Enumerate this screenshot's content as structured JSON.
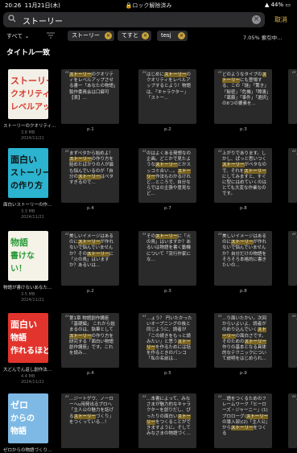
{
  "status": {
    "time": "20:26",
    "date": "11月21日(木)",
    "lock": "ロック解除済み",
    "battery": "44%"
  },
  "search": {
    "query": "ストーリー",
    "cancel": "取消"
  },
  "filter": {
    "dropdown": "すべて ⌄",
    "chips": [
      "ストーリー",
      "てすと",
      "tesj"
    ],
    "progress": "7.05% 索引中..."
  },
  "section_title": "タイトル一致",
  "rows": [
    {
      "name": "ストーリーのクオリティ...",
      "size": "3.8 MB",
      "date": "2024/11/21",
      "cover": {
        "bg": "#f2efe6",
        "fg": "#d83a2e",
        "lines": [
          "ストーリーの",
          "クオリティを",
          "レベルアップ"
        ]
      },
      "cards": [
        {
          "text": "ストーリーのクオリティをレベルアップさせる書一「あなたの物語」製作委員会は口癖可【表】...",
          "hl": "ストーリー",
          "page": "p.1"
        },
        {
          "text": "はじめにストーリーのクオリティをレベルアップするとよう！物語は、「キャラクター」「ストー...",
          "hl": "ストーリー",
          "page": "p.2"
        },
        {
          "text": "どのようなタイプのストーリーにも登場する、この「謎」「驚き」「秘密」「危機」「障害」「葛藤」「事件」「選択」の6つの要素を...",
          "hl": "ストーリー",
          "page": "p.3"
        },
        {
          "text": "…",
          "hl": "",
          "page": ""
        }
      ]
    },
    {
      "name": "面白いストーリーの作...",
      "size": "3.3 MB",
      "date": "2024/11/21",
      "cover": {
        "bg": "#2bb3cf",
        "fg": "#111",
        "lines": [
          "面白い",
          "ストーリー",
          "の作り方"
        ]
      },
      "cards": [
        {
          "text": "まずペタから始めよ！ストーリーの作り方を始めたばかりの人が最も悩んでいるのが「自分のストーリーはペタすぎるので...",
          "hl": "ストーリー",
          "page": "p.4"
        },
        {
          "text": "のはよくある発想なの企画。どこかで見たようなストーリーとかスッコミ合い…。ストーリー作法もわかるけれど…ところで、自分ならではの主張や意見など...",
          "hl": "ストーリー",
          "page": "p.7"
        },
        {
          "text": "上がりであります。しかし、ぱっと思いつくストーリーがペタなので、それをストーリーにしてみますと、すぐに型にはめていくのはとても大変な作業なのです。",
          "hl": "ストーリー",
          "page": "p.8"
        },
        {
          "text": "…",
          "hl": "",
          "page": ""
        }
      ]
    },
    {
      "name": "物語が書けないあなた...",
      "size": "3.5 MB",
      "date": "2024/11/21",
      "cover": {
        "bg": "#f5f2e8",
        "fg": "#2a9a3a",
        "lines": [
          "物語",
          "書けな",
          "い！"
        ]
      },
      "cards": [
        {
          "text": "美しいイメージはあるのにストーリーが作れないで悩んでいませんか？そのストーリーに「火の鳥」はいますか？あるいは...",
          "hl": "ストーリー",
          "page": "p.2"
        },
        {
          "text": "そのストーリーに「火の鳥」はいますか？あるいは物語を書く動機について「流行作家にな...",
          "hl": "ストーリー",
          "page": "p.3"
        },
        {
          "text": "美しいイメージはあるのにストーリーが作れないで悩んでいませんか？自分だけの物語をそろそろ本格的に書きたいの...",
          "hl": "ストーリー",
          "page": "p.8"
        },
        {
          "text": "…",
          "hl": "",
          "page": ""
        }
      ]
    },
    {
      "name": "大どんでん返し創作法...",
      "size": "4.4 MB",
      "date": "2024/11/21",
      "cover": {
        "bg": "#e2342c",
        "fg": "#fff",
        "lines": [
          "面白い",
          "物語",
          "作れるほど"
        ]
      },
      "cards": [
        {
          "text": "第1章 物語創作講座「基礎編」 これから始まるのは、執筆としてストーリーの作り方を研究する「面白い物語創作講座」です。これを読み...",
          "hl": "ストーリー",
          "page": "p.4"
        },
        {
          "text": "…ょう？ 円いたかったいオープニングの後と同じように、読者が「この続きをもっと読みたい」と思うストーリーを作るためには話を作るときのパンコ「私の名前は…",
          "hl": "ストーリー",
          "page": "p.5"
        },
        {
          "text": "…り面いたかい。次回からいよいよ、読者がのめり込んでいくストーリーの面白さです。そのためのストーリー作りの基本となる具体的なテクニックについて説明をはじめられ...",
          "hl": "ストーリー",
          "page": "p.9"
        },
        {
          "text": "…",
          "hl": "",
          "page": ""
        }
      ]
    },
    {
      "name": "ゼロからの物語づくり...",
      "size": "",
      "date": "",
      "cover": {
        "bg": "#7db9e4",
        "fg": "#fff",
        "lines": [
          "ゼロ",
          "からの",
          "物語"
        ]
      },
      "cards": [
        {
          "text": "…ジートゲウ、ノーローヘu用発出るプロヘ「主人公の魅力を話げるストーリーづくり」をつくっている…！",
          "hl": "ストーリー",
          "page": ""
        },
        {
          "text": "…本書によって、みなさまが魅力的なキャラクターを創りだし、ぴったりの面白いストーリーをつくることができますように。そしてみなさまの物語づく...",
          "hl": "ストーリー",
          "page": ""
        },
        {
          "text": "…語をつくるためのフレームワーク「ヒーローズ・ジャーニー」(1) プロローグ(ストーリーの導入部)(2)「主人公」からストーリーをつくる",
          "hl": "ストーリー",
          "page": ""
        },
        {
          "text": "…",
          "hl": "",
          "page": ""
        }
      ]
    }
  ],
  "colors": {
    "accent": "#e0b84a",
    "highlight": "#7a6420",
    "card": "#2a2a2a"
  }
}
